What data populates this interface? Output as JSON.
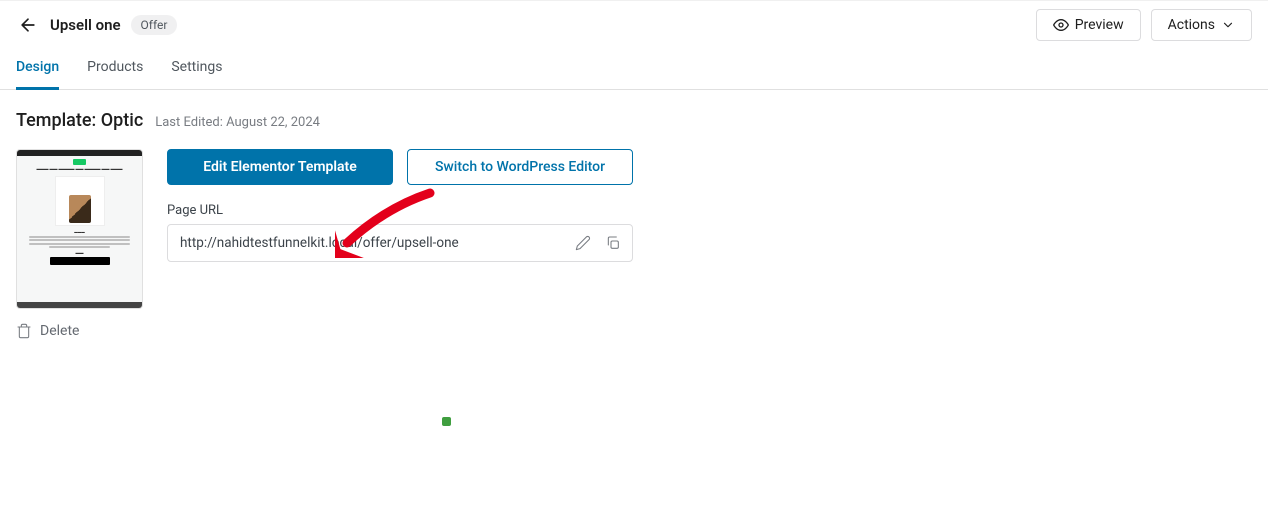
{
  "header": {
    "title": "Upsell one",
    "chip": "Offer",
    "preview": "Preview",
    "actions": "Actions"
  },
  "tabs": {
    "design": "Design",
    "products": "Products",
    "settings": "Settings"
  },
  "template": {
    "title": "Template: Optic",
    "last_edited": "Last Edited: August 22, 2024",
    "edit_btn": "Edit Elementor Template",
    "switch_btn": "Switch to WordPress Editor",
    "url_label": "Page URL",
    "url_value": "http://nahidtestfunnelkit.local/offer/upsell-one",
    "delete": "Delete"
  }
}
